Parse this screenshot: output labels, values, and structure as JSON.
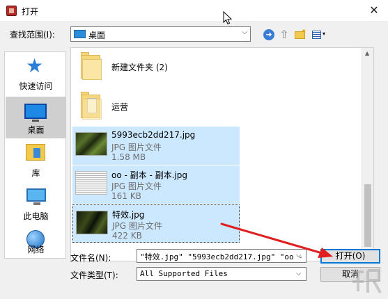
{
  "window": {
    "title": "打开",
    "close_glyph": "✕"
  },
  "toolbar": {
    "lookin_label": "查找范围(I):",
    "lookin_value": "桌面",
    "lookin_icon": "desktop-folder-icon",
    "back_glyph": "➜",
    "up_glyph": "⇧",
    "view_arrow": "▾"
  },
  "places": [
    {
      "label": "快速访问",
      "icon": "quick-access-star-icon"
    },
    {
      "label": "桌面",
      "icon": "desktop-icon",
      "selected": true
    },
    {
      "label": "库",
      "icon": "library-icon"
    },
    {
      "label": "此电脑",
      "icon": "this-pc-icon"
    },
    {
      "label": "网络",
      "icon": "network-icon"
    }
  ],
  "files": [
    {
      "name": "新建文件夹 (2)",
      "kind": "folder"
    },
    {
      "name": "运营",
      "kind": "folder"
    },
    {
      "name": "5993ecb2dd217.jpg",
      "type": "JPG 图片文件",
      "size": "1.58 MB",
      "selected": true
    },
    {
      "name": "oo - 副本 - 副本.jpg",
      "type": "JPG 图片文件",
      "size": "161 KB",
      "selected": true
    },
    {
      "name": "特效.jpg",
      "type": "JPG 图片文件",
      "size": "422 KB",
      "selected": true,
      "focused": true
    }
  ],
  "scrollbar": {
    "up_glyph": "▲",
    "down_glyph": "▼"
  },
  "form": {
    "filename_label": "文件名(N):",
    "filename_value": "\"特效.jpg\" \"5993ecb2dd217.jpg\" \"oo -",
    "filetype_label": "文件类型(T):",
    "filetype_value": "All Supported Files",
    "dropdown_glyph": "⌵"
  },
  "buttons": {
    "open": "打开(O)",
    "cancel": "取消"
  },
  "colors": {
    "selection": "#cce8ff",
    "annotation_arrow": "#e02020",
    "accent": "#0078d7"
  }
}
